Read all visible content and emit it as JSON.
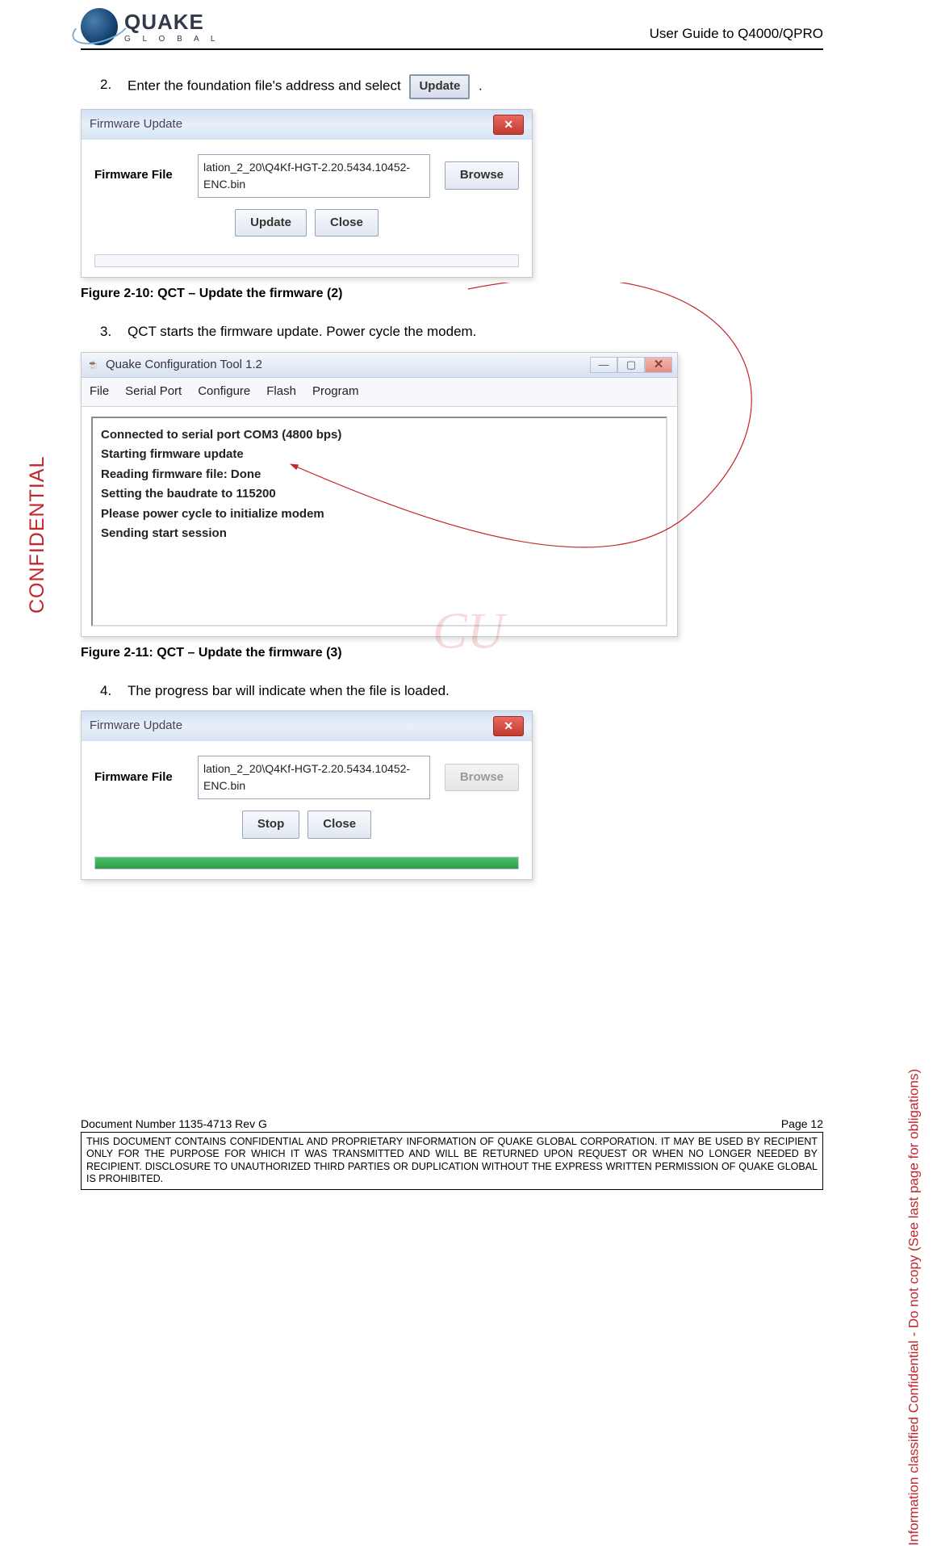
{
  "header": {
    "brand_main": "QUAKE",
    "brand_sub": "G L O B A L",
    "title": "User Guide to Q4000/QPRO"
  },
  "steps": {
    "s2_num": "2.",
    "s2_text_a": "Enter the foundation file's address and select  ",
    "s2_btn": "Update",
    "s2_text_b": " .",
    "s3_num": "3.",
    "s3_text": "QCT starts the firmware update.  Power cycle the modem.",
    "s4_num": "4.",
    "s4_text": "The progress bar will indicate when the file is loaded."
  },
  "fig1": {
    "title": "Firmware Update",
    "label": "Firmware File",
    "path": "lation_2_20\\Q4Kf-HGT-2.20.5434.10452-ENC.bin",
    "browse": "Browse",
    "update": "Update",
    "close": "Close",
    "caption": "Figure 2-10:  QCT – Update the firmware (2)"
  },
  "fig2": {
    "wintitle": "Quake Configuration Tool 1.2",
    "menu": [
      "File",
      "Serial Port",
      "Configure",
      "Flash",
      "Program"
    ],
    "lines": [
      "Connected to serial port COM3 (4800 bps)",
      "",
      "Starting firmware update",
      "Reading firmware file: Done",
      "Setting the baudrate to 115200",
      "Please power cycle to initialize modem",
      "Sending start session"
    ],
    "caption": "Figure 2-11:  QCT – Update the firmware (3)"
  },
  "fig3": {
    "title": "Firmware Update",
    "label": "Firmware File",
    "path": "lation_2_20\\Q4Kf-HGT-2.20.5434.10452-ENC.bin",
    "browse": "Browse",
    "stop": "Stop",
    "close": "Close"
  },
  "side": {
    "left": "CONFIDENTIAL",
    "right": "Information classified Confidential - Do not copy (See last page for obligations)"
  },
  "footer": {
    "doc": "Document Number 1135-4713   Rev G",
    "page": "Page 12",
    "legal": "THIS DOCUMENT CONTAINS CONFIDENTIAL AND PROPRIETARY INFORMATION OF QUAKE GLOBAL CORPORATION.  IT MAY BE USED BY RECIPIENT ONLY FOR THE PURPOSE FOR WHICH IT WAS TRANSMITTED AND WILL BE RETURNED UPON REQUEST OR WHEN NO LONGER NEEDED BY RECIPIENT.  DISCLOSURE TO UNAUTHORIZED THIRD PARTIES OR DUPLICATION WITHOUT THE EXPRESS WRITTEN PERMISSION OF QUAKE GLOBAL IS PROHIBITED."
  },
  "watermark": "CU"
}
